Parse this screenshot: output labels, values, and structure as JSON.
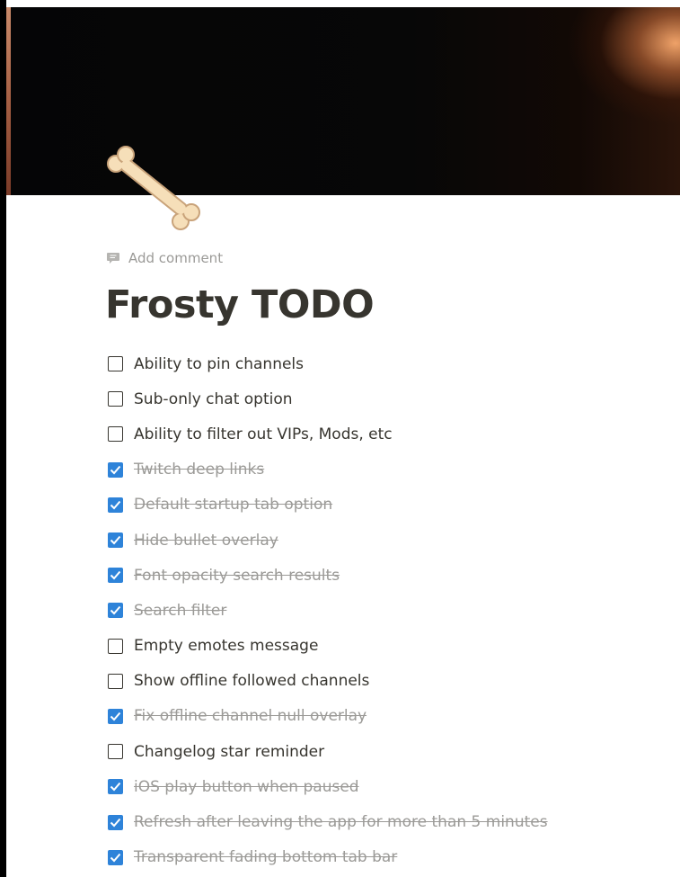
{
  "cover": {
    "image": "dark-cover-with-warm-light"
  },
  "page_icon": "bone-icon",
  "add_comment_label": "Add comment",
  "title": "Frosty TODO",
  "colors": {
    "checked": "#2e83d9",
    "text": "#37352f",
    "muted": "#9b9a97"
  },
  "todos": [
    {
      "label": "Ability to pin channels",
      "checked": false
    },
    {
      "label": "Sub-only chat option",
      "checked": false
    },
    {
      "label": "Ability to filter out VIPs, Mods, etc",
      "checked": false
    },
    {
      "label": "Twitch deep links",
      "checked": true
    },
    {
      "label": "Default startup tab option",
      "checked": true
    },
    {
      "label": "Hide bullet overlay",
      "checked": true
    },
    {
      "label": "Font opacity search results",
      "checked": true
    },
    {
      "label": "Search filter",
      "checked": true
    },
    {
      "label": "Empty emotes message",
      "checked": false
    },
    {
      "label": "Show offline followed channels",
      "checked": false
    },
    {
      "label": "Fix offline channel null overlay",
      "checked": true
    },
    {
      "label": "Changelog star reminder",
      "checked": false
    },
    {
      "label": "iOS play button when paused",
      "checked": true
    },
    {
      "label": "Refresh after leaving the app for more than 5 minutes",
      "checked": true
    },
    {
      "label": "Transparent fading bottom tab bar",
      "checked": true
    }
  ]
}
